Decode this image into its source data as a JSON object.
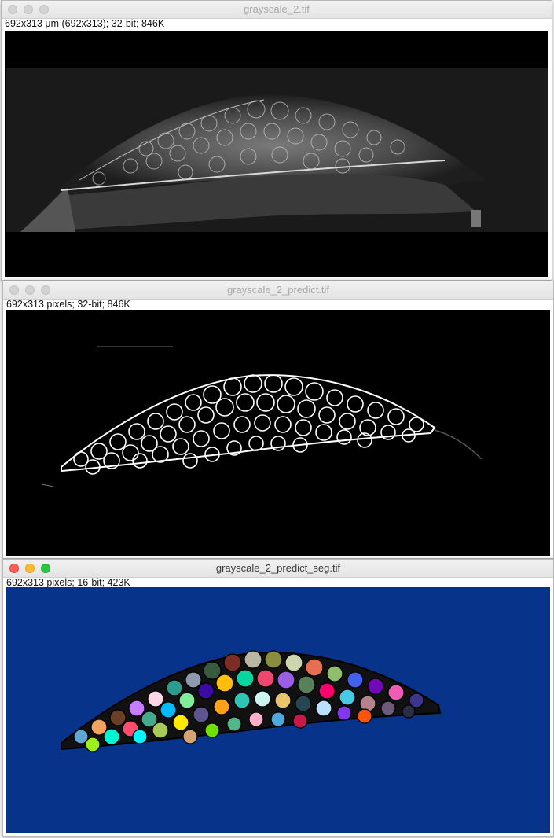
{
  "windows": [
    {
      "title": "grayscale_2.tif",
      "info": "692x313 μm (692x313); 32-bit; 846K"
    },
    {
      "title": "grayscale_2_predict.tif",
      "info": "692x313 pixels; 32-bit; 846K"
    },
    {
      "title": "grayscale_2_predict_seg.tif",
      "info": "692x313 pixels; 16-bit; 423K"
    }
  ],
  "colors": {
    "seg_background": "#08338a",
    "close": "#fd5f57",
    "minimize": "#febc2e",
    "maximize": "#28c840"
  }
}
